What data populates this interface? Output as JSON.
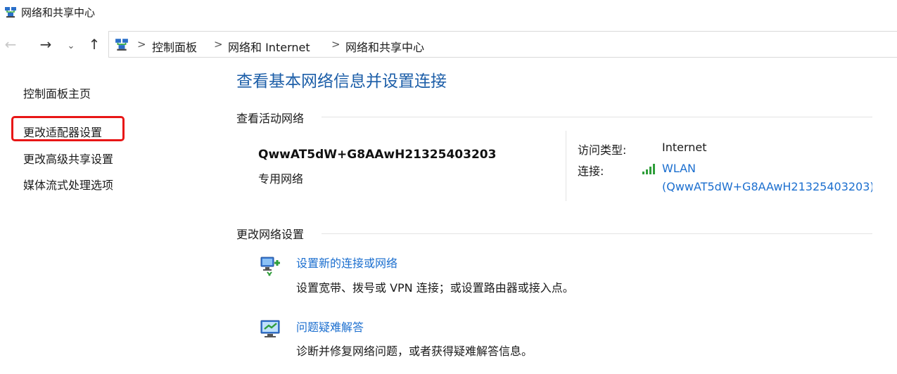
{
  "window": {
    "title": "网络和共享中心",
    "icon": "network-center-icon"
  },
  "nav": {
    "back": "←",
    "forward": "→",
    "recent": "⌄",
    "up": "↑",
    "breadcrumb": [
      "控制面板",
      "网络和 Internet",
      "网络和共享中心"
    ],
    "separator": ">"
  },
  "sidebar": {
    "items": [
      {
        "label": "控制面板主页"
      },
      {
        "label": "更改适配器设置",
        "highlighted": true
      },
      {
        "label": "更改高级共享设置"
      },
      {
        "label": "媒体流式处理选项"
      }
    ],
    "highlight_color": "#e81616"
  },
  "main": {
    "title": "查看基本网络信息并设置连接",
    "active_networks_heading": "查看活动网络",
    "network": {
      "name": "QwwAT5dW+G8AAwH21325403203",
      "type": "专用网络",
      "access_type_label": "访问类型:",
      "access_type_value": "Internet",
      "connections_label": "连接:",
      "connection_name": "WLAN",
      "connection_detail": "(QwwAT5dW+G8AAwH21325403203)"
    },
    "change_settings_heading": "更改网络设置",
    "tasks": [
      {
        "icon": "new-connection-icon",
        "link": "设置新的连接或网络",
        "description": "设置宽带、拨号或 VPN 连接；或设置路由器或接入点。"
      },
      {
        "icon": "troubleshoot-icon",
        "link": "问题疑难解答",
        "description": "诊断并修复网络问题，或者获得疑难解答信息。"
      }
    ]
  },
  "colors": {
    "title_blue": "#1c5ea8",
    "link_blue": "#1c6fcf",
    "text": "#1a1a1a",
    "signal_green": "#2f9e3a"
  }
}
